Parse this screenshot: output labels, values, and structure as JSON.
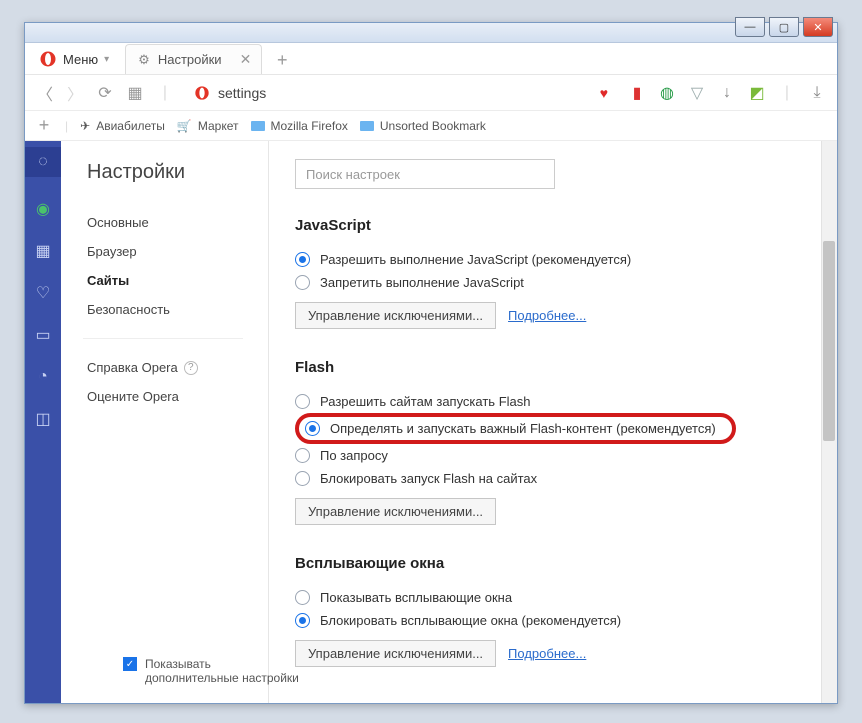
{
  "window": {
    "minimize": "—",
    "maximize": "▢",
    "close": "✕"
  },
  "menu_label": "Меню",
  "tab": {
    "label": "Настройки",
    "close": "✕"
  },
  "addr": {
    "url": "settings"
  },
  "bookmarks": {
    "b1": "Авиабилеты",
    "b2": "Маркет",
    "b3": "Mozilla Firefox",
    "b4": "Unsorted Bookmark"
  },
  "side": {
    "title": "Настройки",
    "i1": "Основные",
    "i2": "Браузер",
    "i3": "Сайты",
    "i4": "Безопасность",
    "help": "Справка Opera",
    "rate": "Оцените Opera",
    "adv": "Показывать дополнительные настройки"
  },
  "search_ph": "Поиск настроек",
  "js": {
    "h": "JavaScript",
    "r1": "Разрешить выполнение JavaScript (рекомендуется)",
    "r2": "Запретить выполнение JavaScript",
    "btn": "Управление исключениями...",
    "more": "Подробнее..."
  },
  "flash": {
    "h": "Flash",
    "r1": "Разрешить сайтам запускать Flash",
    "r2": "Определять и запускать важный Flash-контент (рекомендуется)",
    "r3": "По запросу",
    "r4": "Блокировать запуск Flash на сайтах",
    "btn": "Управление исключениями..."
  },
  "popup": {
    "h": "Всплывающие окна",
    "r1": "Показывать всплывающие окна",
    "r2": "Блокировать всплывающие окна (рекомендуется)",
    "btn": "Управление исключениями...",
    "more": "Подробнее..."
  }
}
